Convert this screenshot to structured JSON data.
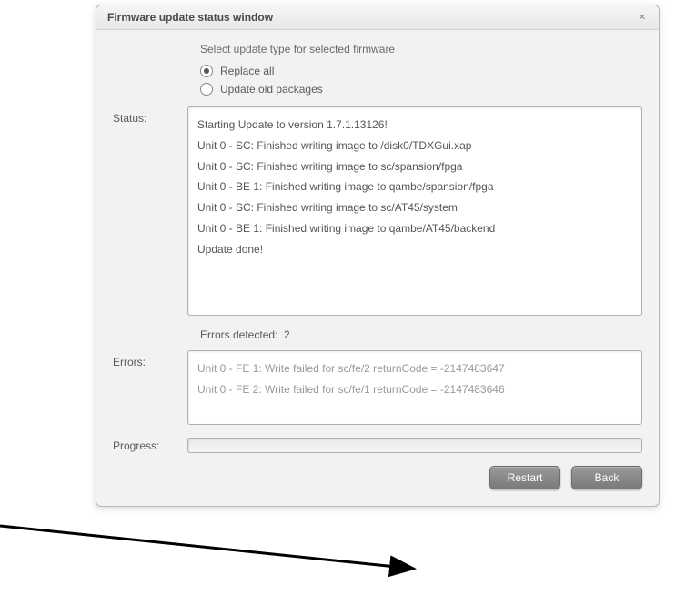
{
  "window": {
    "title": "Firmware update status window",
    "close_glyph": "✕"
  },
  "instruction": "Select update type for selected firmware",
  "radios": {
    "replace_all": "Replace all",
    "update_old": "Update old packages"
  },
  "labels": {
    "status": "Status:",
    "errors": "Errors:",
    "progress": "Progress:"
  },
  "status_lines": [
    "Starting Update to version 1.7.1.13126!",
    "Unit 0 - SC: Finished writing image to /disk0/TDXGui.xap",
    "Unit 0 - SC: Finished writing image to sc/spansion/fpga",
    "Unit 0 - BE 1: Finished writing image to qambe/spansion/fpga",
    "Unit 0 - SC: Finished writing image to sc/AT45/system",
    "Unit 0 - BE 1: Finished writing image to qambe/AT45/backend",
    "Update done!"
  ],
  "errors_detected_label": "Errors detected:",
  "errors_detected_count": "2",
  "error_lines": [
    "Unit 0 - FE 1: Write failed for sc/fe/2 returnCode = -2147483647",
    "Unit 0 - FE 2: Write failed for sc/fe/1 returnCode = -2147483646"
  ],
  "buttons": {
    "restart": "Restart",
    "back": "Back"
  }
}
